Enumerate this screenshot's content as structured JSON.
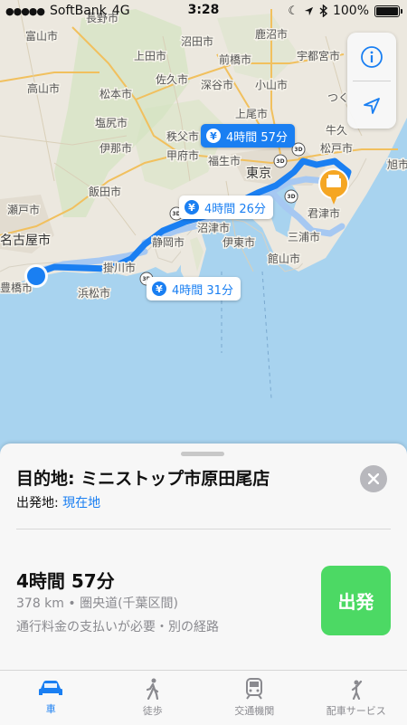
{
  "status_bar": {
    "signal": "●●●●●",
    "carrier": "SoftBank",
    "network": "4G",
    "time": "3:28",
    "battery": "100%"
  },
  "map": {
    "labels": [
      "長野市",
      "富山市",
      "上田市",
      "沼田市",
      "鹿沼市",
      "前橋市",
      "宇都宮市",
      "高山市",
      "佐久市",
      "深谷市",
      "小山市",
      "松本市",
      "つく",
      "塩尻市",
      "上尾市",
      "牛久",
      "伊那市",
      "秩父市",
      "松戸市",
      "甲府市",
      "福生市",
      "東京",
      "旭市",
      "飯田市",
      "沼津市",
      "君津市",
      "瀬戸市",
      "静岡市",
      "伊東市",
      "三浦市",
      "名古屋市",
      "館山市",
      "掛川市",
      "豊橋市",
      "浜松市"
    ],
    "shields": [
      "3D",
      "3D",
      "3D",
      "3D",
      "3D"
    ]
  },
  "map_controls": {
    "info_icon": "info-icon",
    "location_icon": "location-arrow-icon"
  },
  "route_labels": {
    "primary": "4時間 57分",
    "alt1": "4時間 26分",
    "alt2": "4時間 31分",
    "currency": "¥"
  },
  "sheet": {
    "destination": "目的地: ミニストップ市原田尾店",
    "origin_label": "出発地: ",
    "origin_value": "現在地",
    "duration": "4時間 57分",
    "summary": "378 km • 圏央道(千葉区間)",
    "notes": "通行料金の支払いが必要・別の経路",
    "go_label": "出発"
  },
  "tabs": [
    {
      "label": "車",
      "icon": "car-icon",
      "active": true
    },
    {
      "label": "徒歩",
      "icon": "walking-icon",
      "active": false
    },
    {
      "label": "交通機関",
      "icon": "train-icon",
      "active": false
    },
    {
      "label": "配車サービス",
      "icon": "rideshare-icon",
      "active": false
    }
  ],
  "colors": {
    "accent": "#1a7ff2",
    "go": "#4cd964",
    "water": "#a8d3ef",
    "land": "#ece8df"
  }
}
